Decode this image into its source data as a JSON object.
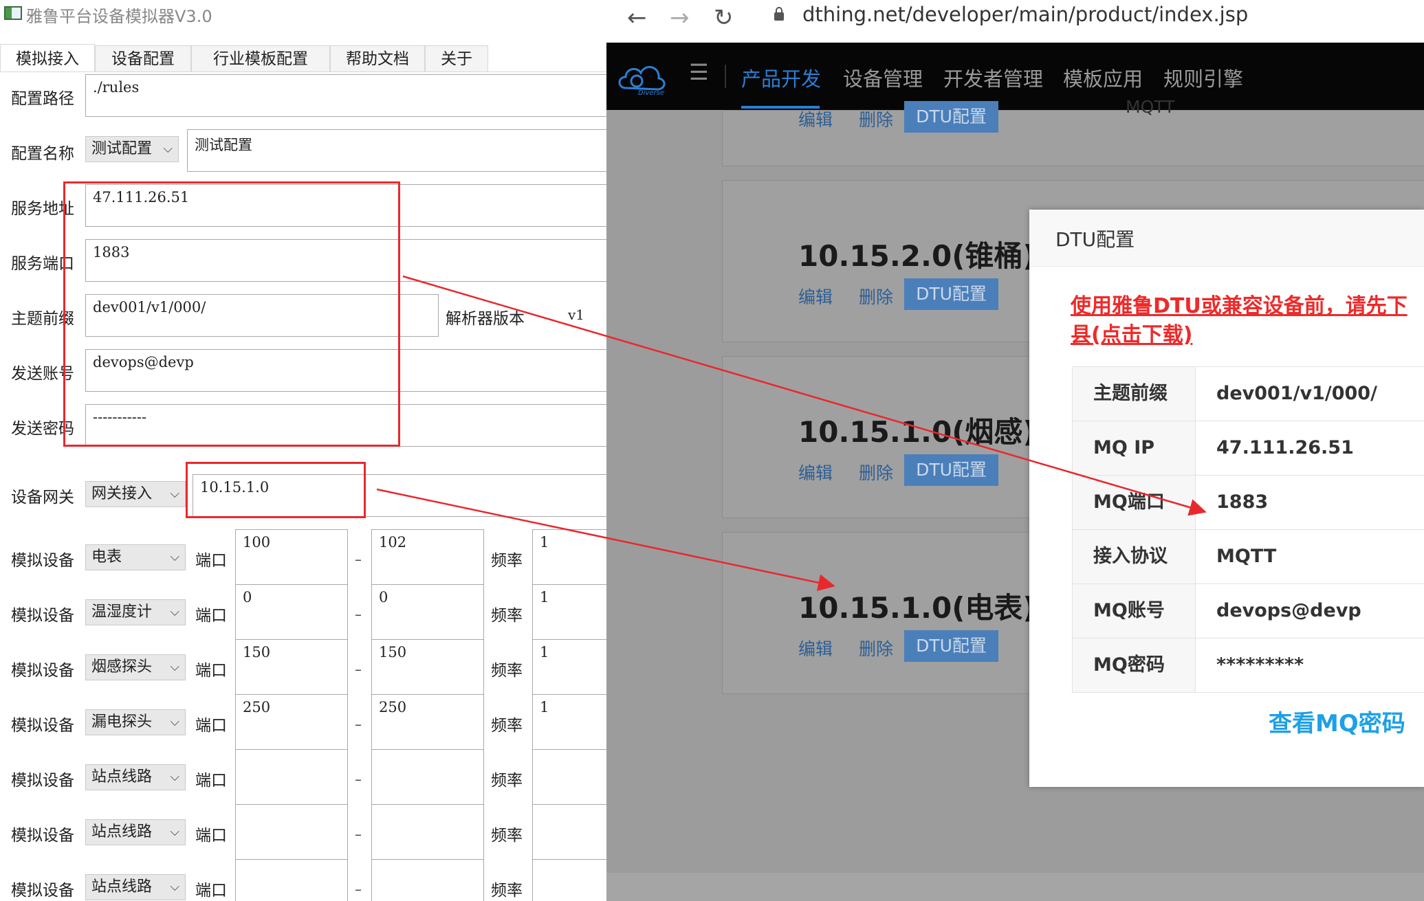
{
  "simulator": {
    "title": "雅鲁平台设备模拟器V3.0",
    "tabs": [
      "模拟接入",
      "设备配置",
      "行业模板配置",
      "帮助文档",
      "关于"
    ],
    "config_path_label": "配置路径",
    "config_path_value": "./rules",
    "config_name_label": "配置名称",
    "config_name_select": "测试配置",
    "config_name_value": "测试配置",
    "server_addr_label": "服务地址",
    "server_addr_value": "47.111.26.51",
    "server_port_label": "服务端口",
    "server_port_value": "1883",
    "topic_prefix_label": "主题前缀",
    "topic_prefix_value": "dev001/v1/000/",
    "parser_version_label": "解析器版本",
    "parser_version_value": "v1",
    "send_account_label": "发送账号",
    "send_account_value": "devops@devp",
    "send_password_label": "发送密码",
    "send_password_value": "-----------",
    "gateway_label": "设备网关",
    "gateway_select": "网关接入",
    "gateway_value": "10.15.1.0",
    "device_rows": [
      {
        "label": "模拟设备",
        "device": "电表",
        "port_label": "端口",
        "port_from": "100",
        "dash": "–",
        "port_to": "102",
        "freq_label": "频率",
        "freq": "1"
      },
      {
        "label": "模拟设备",
        "device": "温湿度计",
        "port_label": "端口",
        "port_from": "0",
        "dash": "–",
        "port_to": "0",
        "freq_label": "频率",
        "freq": "1"
      },
      {
        "label": "模拟设备",
        "device": "烟感探头",
        "port_label": "端口",
        "port_from": "150",
        "dash": "–",
        "port_to": "150",
        "freq_label": "频率",
        "freq": "1"
      },
      {
        "label": "模拟设备",
        "device": "漏电探头",
        "port_label": "端口",
        "port_from": "250",
        "dash": "–",
        "port_to": "250",
        "freq_label": "频率",
        "freq": "1"
      },
      {
        "label": "模拟设备",
        "device": "站点线路",
        "port_label": "端口",
        "port_from": "",
        "dash": "–",
        "port_to": "",
        "freq_label": "频率",
        "freq": ""
      },
      {
        "label": "模拟设备",
        "device": "站点线路",
        "port_label": "端口",
        "port_from": "",
        "dash": "–",
        "port_to": "",
        "freq_label": "频率",
        "freq": ""
      },
      {
        "label": "模拟设备",
        "device": "站点线路",
        "port_label": "端口",
        "port_from": "",
        "dash": "–",
        "port_to": "",
        "freq_label": "频率",
        "freq": ""
      }
    ]
  },
  "browser": {
    "url": "dthing.net/developer/main/product/index.jsp",
    "logo_text": "Diverse",
    "nav": [
      "产品开发",
      "设备管理",
      "开发者管理",
      "模板应用",
      "规则引擎"
    ],
    "partial_top_text": "MQTT",
    "products": [
      {
        "name": "10.15.2.0(锥桶)"
      },
      {
        "name": "10.15.1.0(烟感)"
      },
      {
        "name": "10.15.1.0(电表)"
      }
    ],
    "edit_label": "编辑",
    "delete_label": "删除",
    "dtu_label": "DTU配置"
  },
  "modal": {
    "title": "DTU配置",
    "warning_line1": "使用雅鲁DTU或兼容设备前，请先下",
    "warning_line2": "县(点击下载)",
    "rows": [
      {
        "key": "主题前缀",
        "value": "dev001/v1/000/"
      },
      {
        "key": "MQ IP",
        "value": "47.111.26.51"
      },
      {
        "key": "MQ端口",
        "value": "1883"
      },
      {
        "key": "接入协议",
        "value": "MQTT"
      },
      {
        "key": "MQ账号",
        "value": "devops@devp"
      },
      {
        "key": "MQ密码",
        "value": "*********"
      }
    ],
    "view_password_link": "查看MQ密码"
  },
  "colors": {
    "annotation_red": "#e8282d",
    "nav_active": "#2a7fd4",
    "link_blue": "#1ea0e6",
    "warning_red": "#ee2a2a"
  }
}
